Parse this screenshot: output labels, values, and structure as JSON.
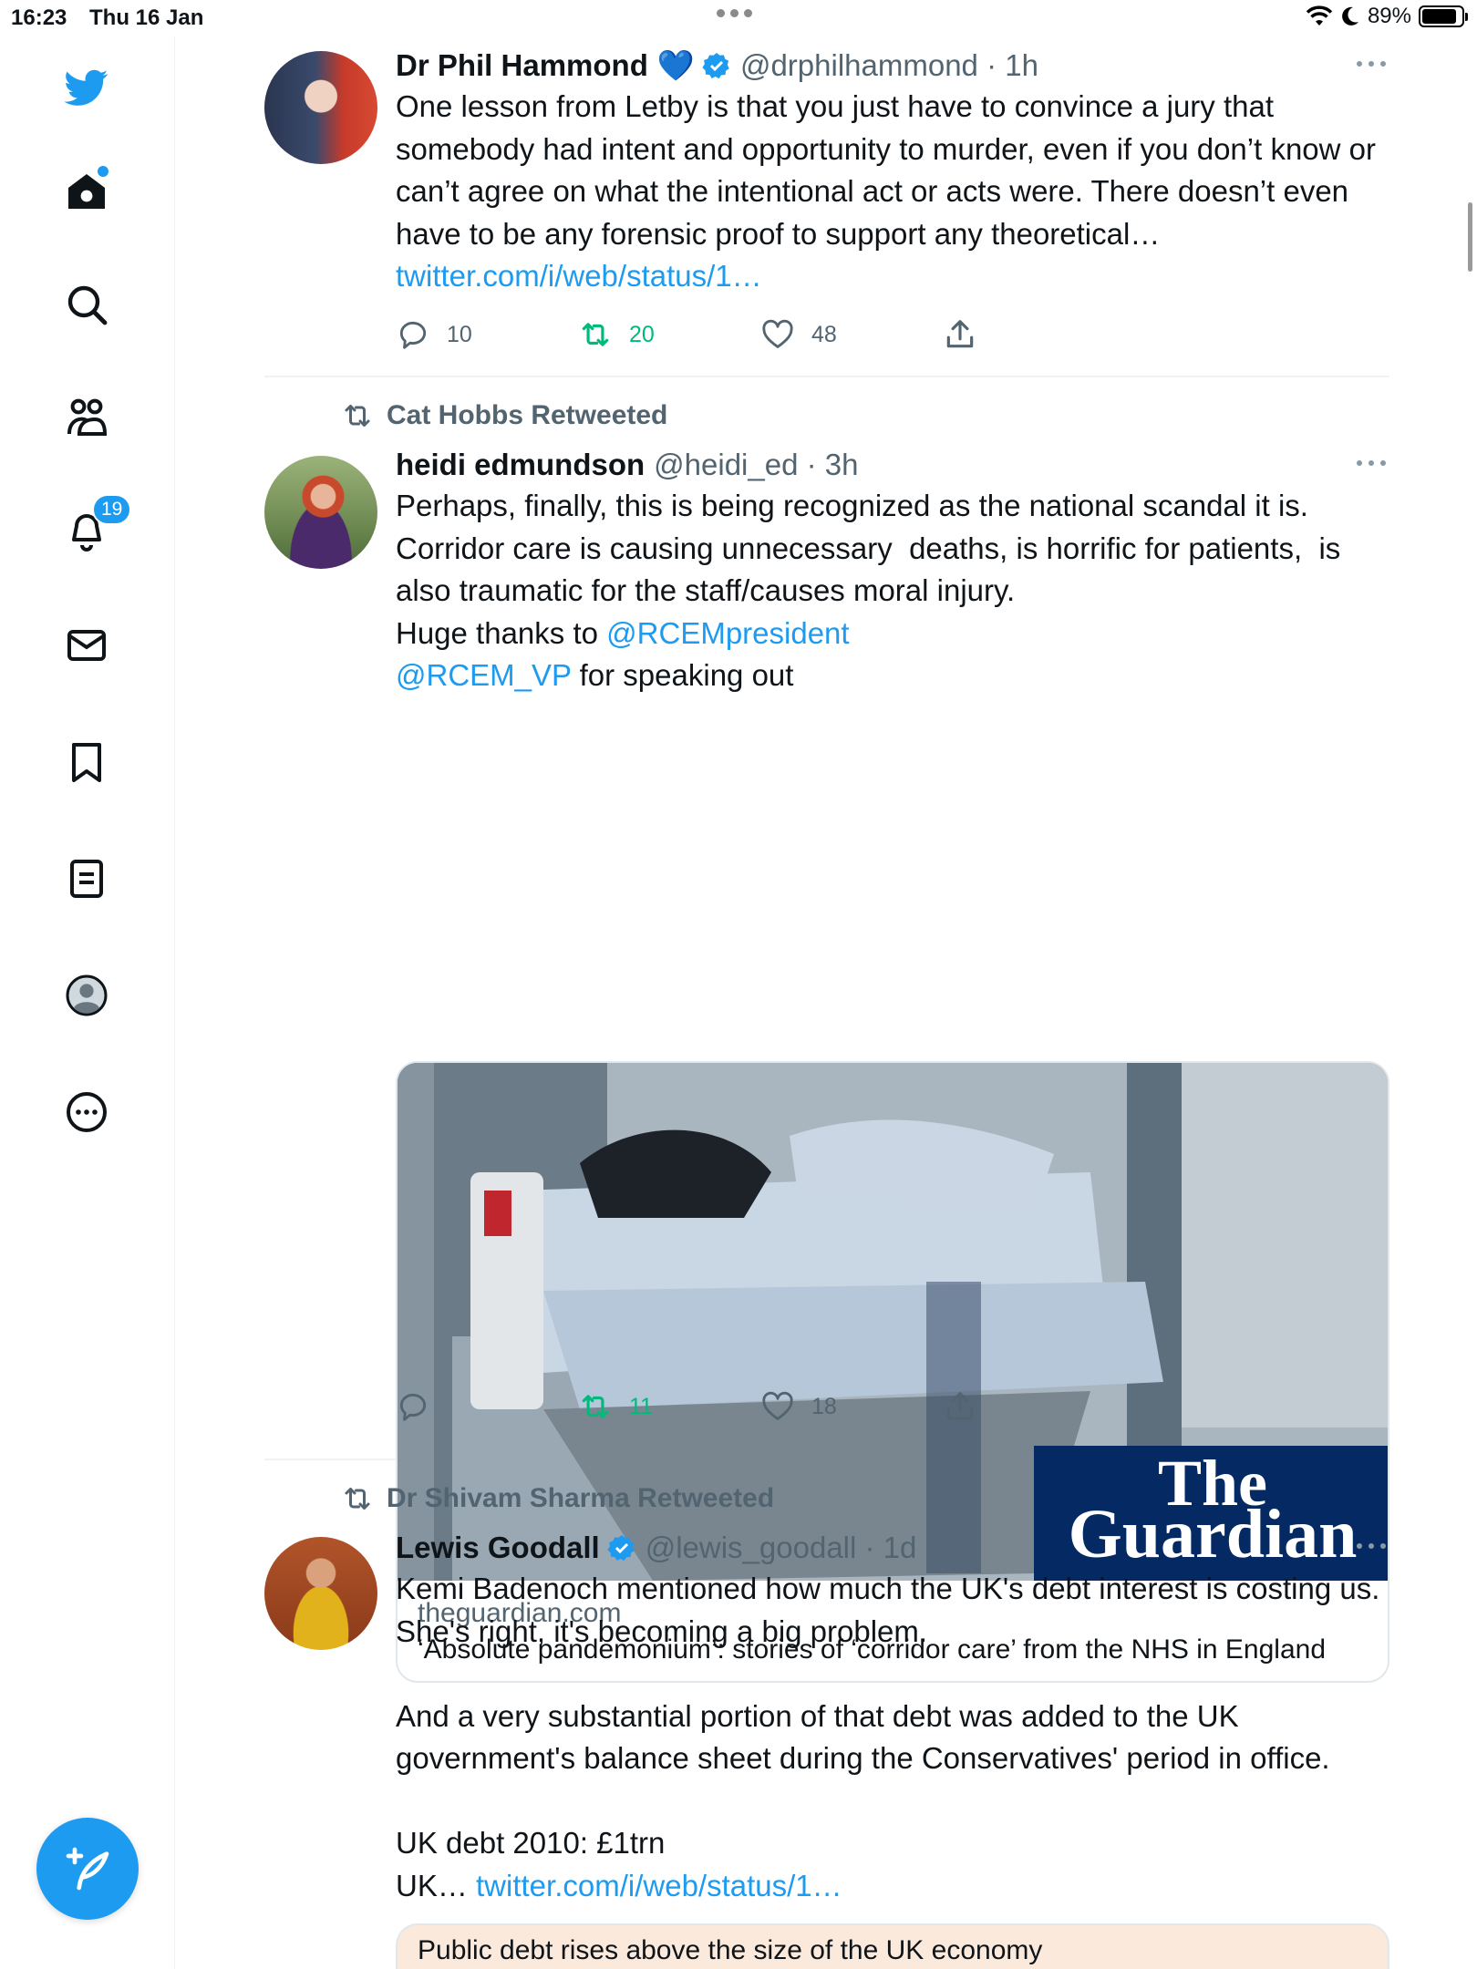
{
  "status_bar": {
    "time": "16:23",
    "date": "Thu 16 Jan",
    "battery": "89%"
  },
  "sidebar": {
    "notifications_badge": "19"
  },
  "tweets": [
    {
      "name": "Dr Phil Hammond",
      "emoji": "💙",
      "handle": "@drphilhammond · 1h",
      "text": "One lesson from Letby is that you just have to convince a jury that somebody had intent and opportunity to murder, even if you don’t know or can’t agree on what the intentional act or acts were. There doesn’t even have to be any forensic proof to support any theoretical…",
      "link": "twitter.com/i/web/status/1…",
      "replies": "10",
      "retweets": "20",
      "likes": "48"
    },
    {
      "retweeted_by": "Cat Hobbs Retweeted",
      "name": "heidi edmundson",
      "handle": "@heidi_ed · 3h",
      "text": "Perhaps, finally, this is being recognized as the national scandal it is.\nCorridor care is causing unnecessary  deaths, is horrific for patients,  is also traumatic for the staff/causes moral injury.\nHuge thanks to ",
      "mention1": "@RCEMpresident",
      "mention2": "@RCEM_VP",
      "text_end": " for speaking out",
      "card": {
        "logo_line1": "The",
        "logo_line2": "Guardian",
        "domain": "theguardian.com",
        "title": "‘Absolute pandemonium’: stories of ‘corridor care’ from the NHS in England"
      },
      "retweets": "11",
      "likes": "18"
    },
    {
      "retweeted_by": "Dr Shivam Sharma Retweeted",
      "name": "Lewis Goodall",
      "handle": "@lewis_goodall · 1d",
      "text": "Kemi Badenoch mentioned how much the UK's debt interest is costing us. She's right, it's becoming a big problem.\n\nAnd a very substantial portion of that debt was added to the UK government's balance sheet during the Conservatives' period in office.\n\nUK debt 2010: £1trn\nUK… ",
      "link": "twitter.com/i/web/status/1…",
      "card_title": "Public debt rises above the size of the UK economy"
    }
  ],
  "colors": {
    "accent": "#1d9bf0",
    "retweet": "#00ba7c",
    "muted": "#536471",
    "guardian": "#052962"
  }
}
